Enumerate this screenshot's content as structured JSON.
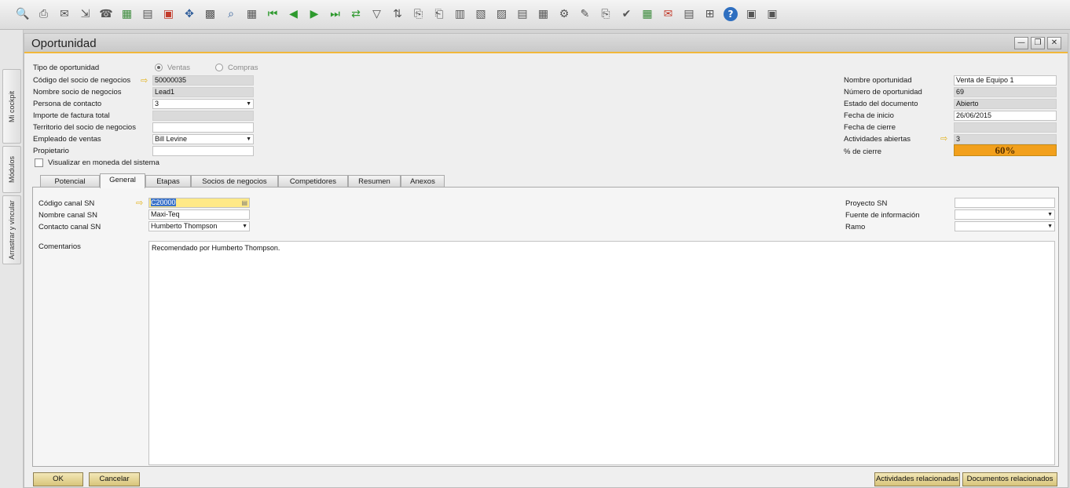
{
  "window": {
    "title": "Oportunidad"
  },
  "side_tabs": [
    "Mi cockpit",
    "Módulos",
    "Arrastrar y vincular"
  ],
  "toolbar_icons": [
    "preview-icon",
    "print-icon",
    "email-icon",
    "export-icon",
    "fax-icon",
    "excel-icon",
    "word-icon",
    "pdf-icon",
    "move-icon",
    "lock-icon",
    "find-icon",
    "add-icon",
    "first-record-icon",
    "previous-record-icon",
    "next-record-icon",
    "last-record-icon",
    "refresh-icon",
    "filter-icon",
    "sort-icon",
    "copy-from-icon",
    "copy-to-icon",
    "base-document-icon",
    "target-document-icon",
    "gross-profit-icon",
    "journal-icon",
    "layout-icon",
    "settings-icon",
    "edit-icon",
    "attachment-icon",
    "approve-icon",
    "calendar-icon",
    "messages-icon",
    "report-icon",
    "tree-icon",
    "help-icon",
    "window-a-icon",
    "window-b-icon"
  ],
  "header": {
    "tipo_label": "Tipo de oportunidad",
    "radio_ventas": "Ventas",
    "radio_compras": "Compras",
    "codigo_label": "Código del socio de negocios",
    "codigo_value": "50000035",
    "nombre_label": "Nombre socio de negocios",
    "nombre_value": "Lead1",
    "persona_label": "Persona de contacto",
    "persona_value": "3",
    "importe_label": "Importe de factura total",
    "importe_value": "",
    "territorio_label": "Territorio del socio de negocios",
    "territorio_value": "",
    "empleado_label": "Empleado de ventas",
    "empleado_value": "Bill Levine",
    "propietario_label": "Propietario",
    "propietario_value": "",
    "visualizar_label": "Visualizar en moneda del sistema"
  },
  "right": {
    "nombre_op_label": "Nombre oportunidad",
    "nombre_op_value": "Venta de Equipo 1",
    "numero_label": "Número de oportunidad",
    "numero_value": "69",
    "estado_label": "Estado del documento",
    "estado_value": "Abierto",
    "fecha_inicio_label": "Fecha de inicio",
    "fecha_inicio_value": "26/06/2015",
    "fecha_cierre_label": "Fecha de cierre",
    "fecha_cierre_value": "",
    "actividades_label": "Actividades abiertas",
    "actividades_value": "3",
    "cierre_label": "% de cierre",
    "cierre_value": "60%"
  },
  "tabs": [
    "Potencial",
    "General",
    "Etapas",
    "Socios de negocios",
    "Competidores",
    "Resumen",
    "Anexos"
  ],
  "active_tab": "General",
  "general": {
    "codigo_canal_label": "Código canal SN",
    "codigo_canal_value": "C20000",
    "nombre_canal_label": "Nombre canal SN",
    "nombre_canal_value": "Maxi-Teq",
    "contacto_canal_label": "Contacto canal SN",
    "contacto_canal_value": "Humberto Thompson",
    "comentarios_label": "Comentarios",
    "comentarios_value": "Recomendado por Humberto Thompson.",
    "proyecto_label": "Proyecto SN",
    "proyecto_value": "",
    "fuente_label": "Fuente de información",
    "fuente_value": "",
    "ramo_label": "Ramo",
    "ramo_value": ""
  },
  "buttons": {
    "ok": "OK",
    "cancelar": "Cancelar",
    "actividades": "Actividades relacionadas",
    "documentos": "Documentos relacionados"
  },
  "colors": {
    "accent": "#f1b83a",
    "closing_bar": "#f2a01c",
    "arrow": "#e3b21a"
  }
}
